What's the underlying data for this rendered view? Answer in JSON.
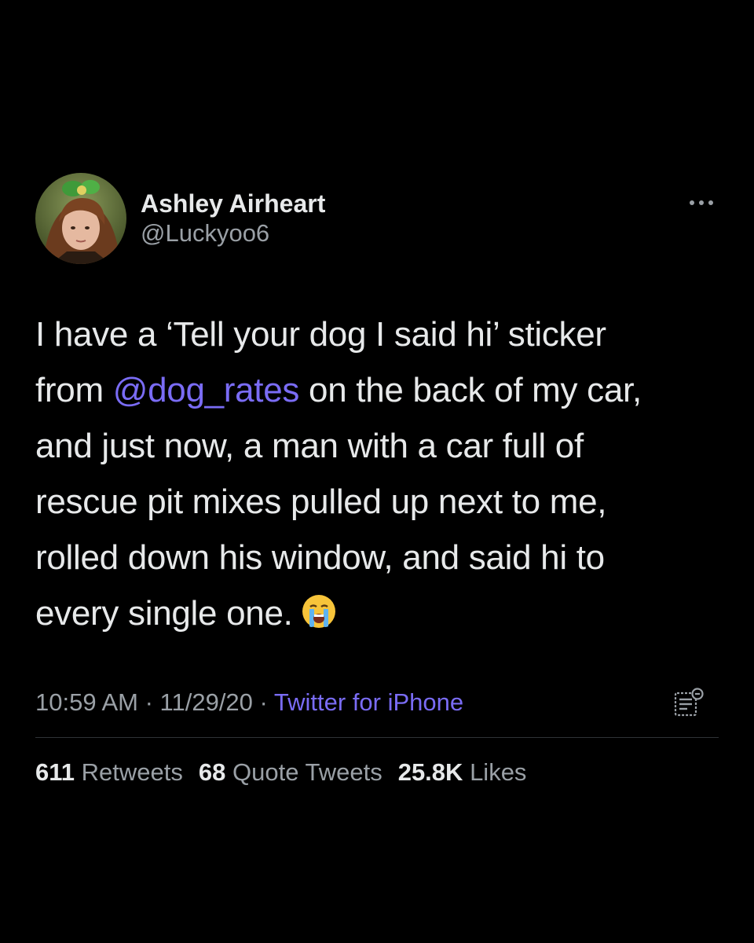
{
  "tweet": {
    "author": {
      "display_name": "Ashley Airheart",
      "handle": "@Luckyoo6",
      "avatar_icon": "avatar-photo"
    },
    "body": {
      "line1": "I have a ‘Tell your dog I said hi’ sticker",
      "line2_before": "from ",
      "line2_mention": "@dog_rates",
      "line2_after": " on the back of my car,",
      "line3": "and just now, a man with a car full of",
      "line4": "rescue pit mixes pulled up next to me,",
      "line5": "rolled down his window, and said hi to",
      "line6": "every single one.",
      "emoji": "crying-face-emoji"
    },
    "meta": {
      "time": "10:59 AM",
      "separator": " · ",
      "date": "11/29/20",
      "source": "Twitter for iPhone"
    },
    "stats": {
      "retweets_count": "611",
      "retweets_label": "Retweets",
      "quotes_count": "68",
      "quotes_label": "Quote Tweets",
      "likes_count": "25.8K",
      "likes_label": "Likes"
    }
  },
  "colors": {
    "background": "#000000",
    "text": "#e7e9ea",
    "secondary": "#9aa0a6",
    "link": "#7a6cf5"
  }
}
